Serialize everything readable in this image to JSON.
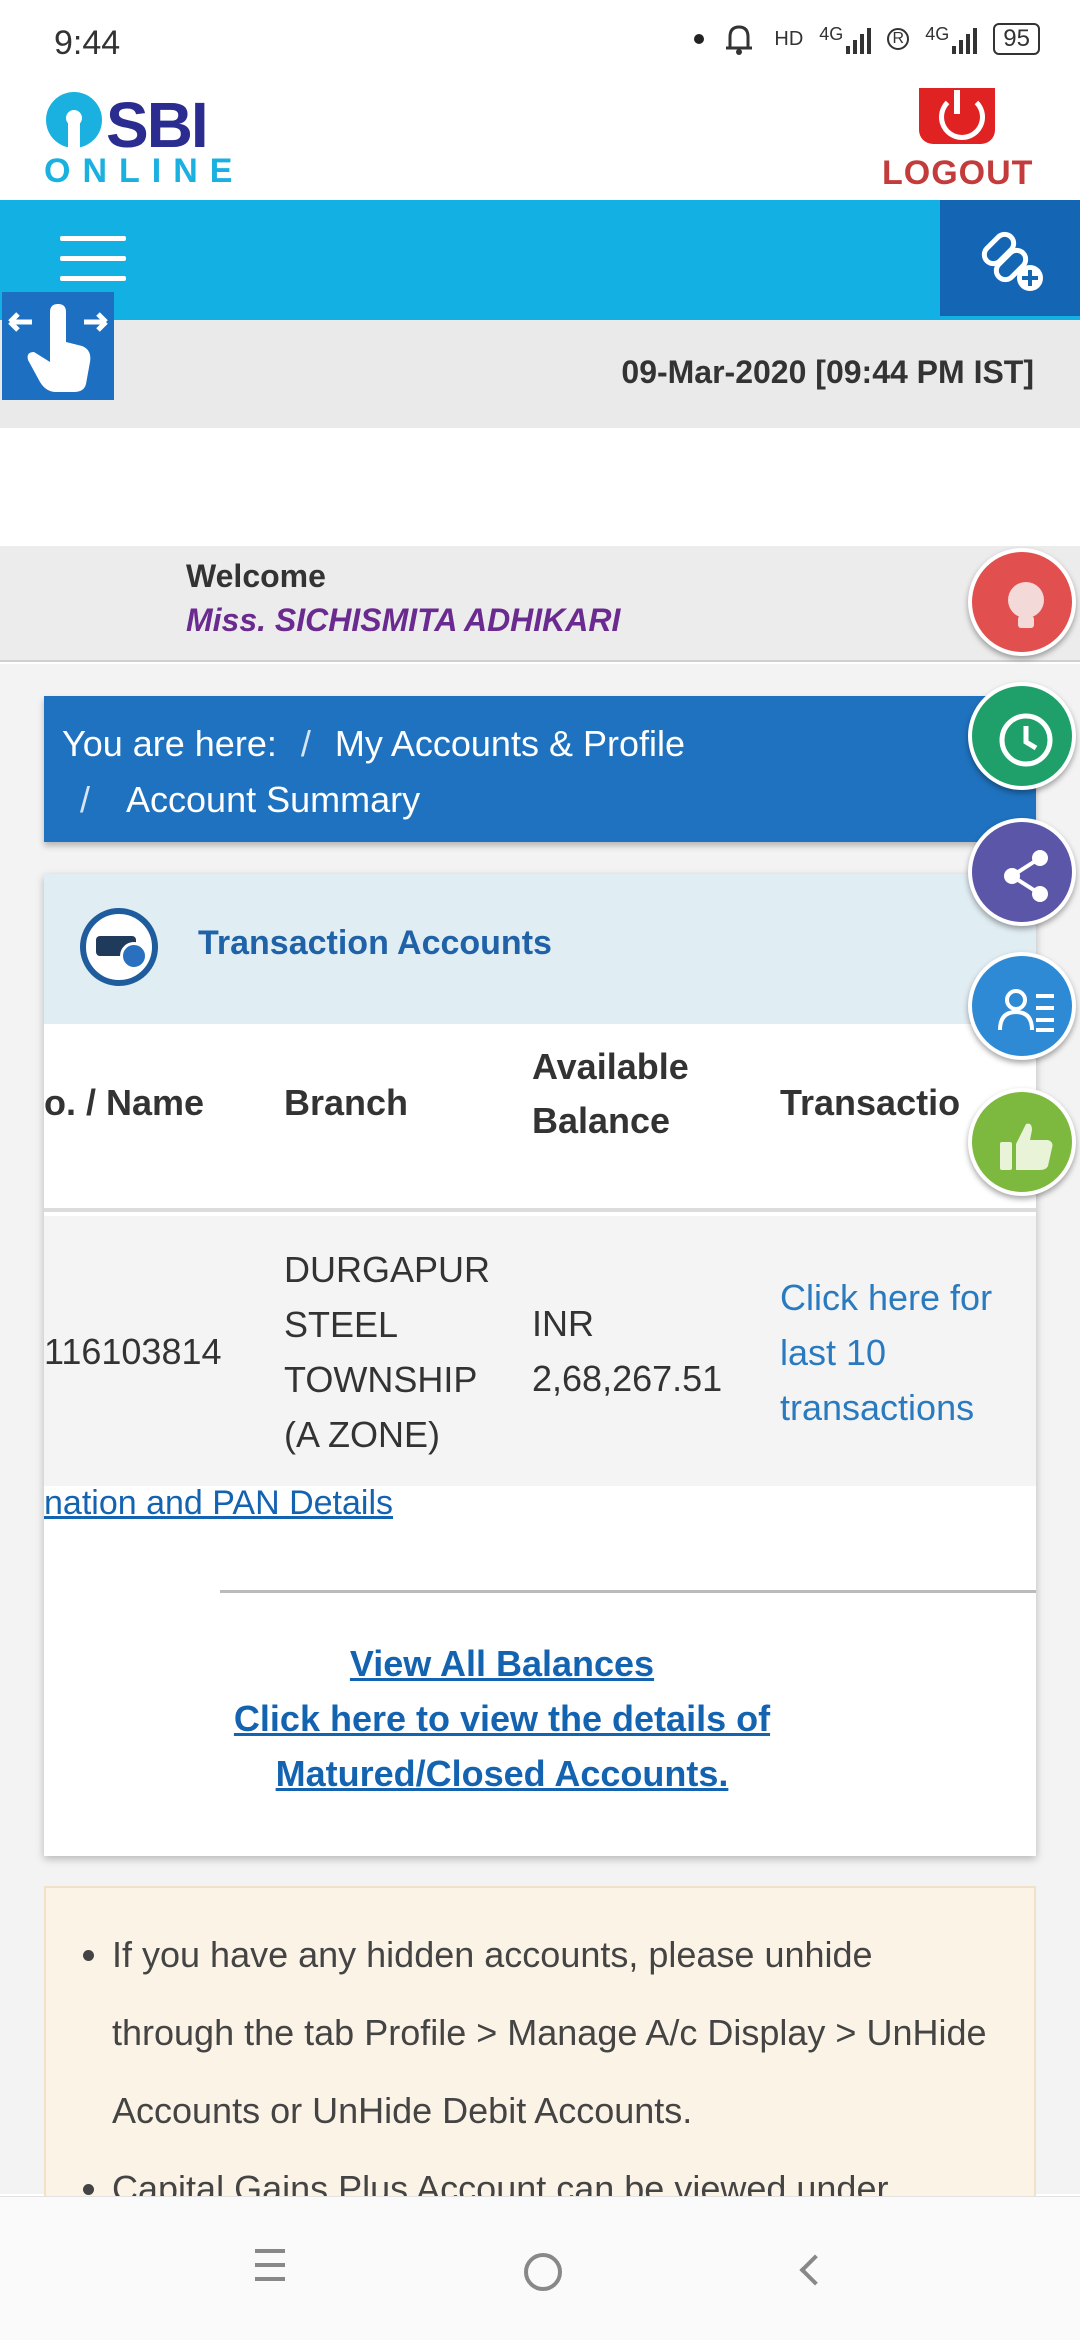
{
  "status_bar": {
    "time": "9:44",
    "network_1": "HD",
    "network_1_type": "4G",
    "network_2_badge": "R",
    "network_2_type": "4G",
    "battery": "95"
  },
  "header": {
    "logo_top": "SBI",
    "logo_bottom": "ONLINE",
    "logout_label": "LOGOUT",
    "logout_icon": "power-icon"
  },
  "navbar": {
    "menu_icon": "hamburger-menu-icon",
    "quick_link_icon": "link-add-icon"
  },
  "dateline": {
    "swipe_icon": "swipe-hand-icon",
    "date_time": "09-Mar-2020 [09:44 PM IST]"
  },
  "welcome": {
    "label": "Welcome",
    "name": "Miss. SICHISMITA ADHIKARI"
  },
  "breadcrumb": {
    "prefix": "You are here:",
    "separator": "/",
    "level1": "My Accounts & Profile",
    "level2": "Account Summary"
  },
  "accounts_panel": {
    "title": "Transaction Accounts",
    "icon": "account-card-icon",
    "columns": [
      "o. / Name",
      "Branch",
      "Available Balance",
      "Transactio"
    ],
    "rows": [
      {
        "account": "116103814",
        "branch": "DURGAPUR STEEL TOWNSHIP (A ZONE)",
        "balance": "INR 2,68,267.51",
        "transactions_link": "Click here for last 10 transactions"
      }
    ],
    "pan_link": "nation and PAN Details",
    "view_all_link": "View All Balances",
    "closed_accounts_link": "Click here to view the details of Matured/Closed Accounts."
  },
  "notice": {
    "items": [
      "If you have any hidden accounts, please unhide through the tab Profile > Manage A/c Display > UnHide Accounts or UnHide Debit Accounts.",
      "Capital Gains Plus Account can be viewed under"
    ]
  },
  "floating_buttons": [
    {
      "name": "idea-bulb-icon",
      "color": "#e14f4f"
    },
    {
      "name": "history-clock-icon",
      "color": "#1fa06a"
    },
    {
      "name": "share-icon",
      "color": "#5b56a8"
    },
    {
      "name": "form-profile-icon",
      "color": "#2f8ad6"
    },
    {
      "name": "thumbs-up-icon",
      "color": "#7db93e"
    }
  ],
  "system_nav": {
    "menu_icon": "recent-apps-icon",
    "home_icon": "home-circle-icon",
    "back_icon": "back-chevron-icon"
  },
  "colors": {
    "brand_blue": "#13b0e3",
    "brand_dark_blue": "#1f72bf",
    "logo_navy": "#2a2d8f",
    "logout_red": "#c43b3b",
    "name_purple": "#6b2a8f",
    "link_blue": "#1463b0"
  }
}
